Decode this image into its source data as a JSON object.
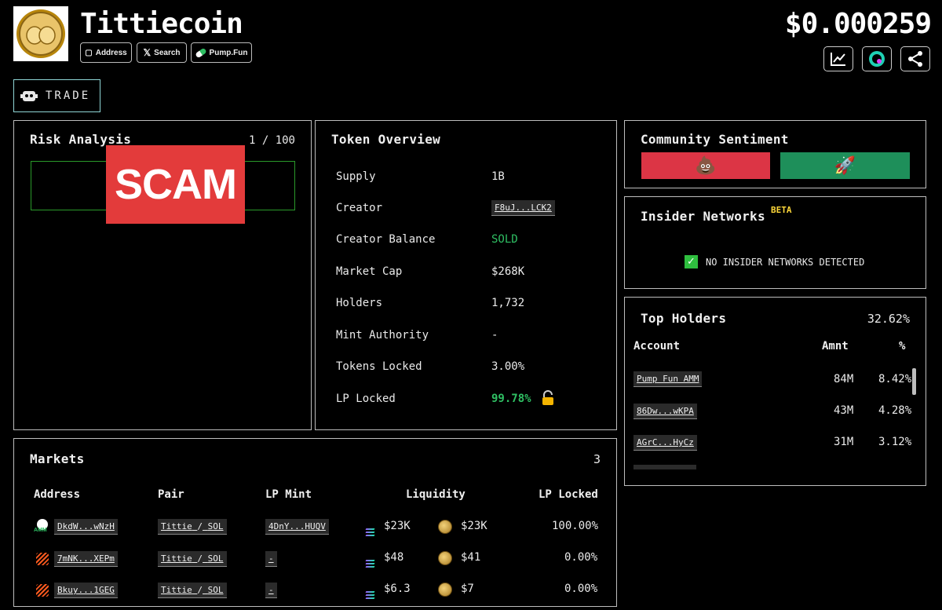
{
  "header": {
    "token_name": "Tittiecoin",
    "price": "$0.000259",
    "links": [
      {
        "label": "Address",
        "icon": "copy-icon"
      },
      {
        "label": "Search",
        "icon": "x-logo-icon"
      },
      {
        "label": "Pump.Fun",
        "icon": "pill-icon"
      }
    ],
    "trade_label": "TRADE"
  },
  "risk": {
    "title": "Risk Analysis",
    "score": "1 / 100",
    "badge": "SCAM"
  },
  "overview": {
    "title": "Token Overview",
    "rows": [
      {
        "label": "Supply",
        "value": "1B"
      },
      {
        "label": "Creator",
        "value": "F8uJ...LCK2"
      },
      {
        "label": "Creator Balance",
        "value": "SOLD"
      },
      {
        "label": "Market Cap",
        "value": "$268K"
      },
      {
        "label": "Holders",
        "value": "1,732"
      },
      {
        "label": "Mint Authority",
        "value": "-"
      },
      {
        "label": "Tokens Locked",
        "value": "3.00%"
      },
      {
        "label": "LP Locked",
        "value": "99.78%"
      }
    ]
  },
  "sentiment": {
    "title": "Community Sentiment",
    "bad_emoji": "💩",
    "good_emoji": "🚀",
    "bad_color": "#dc3545",
    "good_color": "#1e8f5a"
  },
  "insider": {
    "title": "Insider Networks",
    "tag": "BETA",
    "status": "NO INSIDER NETWORKS DETECTED"
  },
  "holders": {
    "title": "Top Holders",
    "total": "32.62%",
    "columns": [
      "Account",
      "Amnt",
      "%"
    ],
    "rows": [
      {
        "account": "Pump Fun AMM",
        "amount": "84M",
        "pct": "8.42%"
      },
      {
        "account": "86Dw...wKPA",
        "amount": "43M",
        "pct": "4.28%"
      },
      {
        "account": "AGrC...HyCz",
        "amount": "31M",
        "pct": "3.12%"
      }
    ]
  },
  "markets": {
    "title": "Markets",
    "count": "3",
    "columns": [
      "Address",
      "Pair",
      "LP Mint",
      "Liquidity",
      "LP Locked"
    ],
    "rows": [
      {
        "address": "DkdW...wNzH",
        "pair_base": "Tittie",
        "pair_sep": "/",
        "pair_quote": "SOL",
        "lp_mint": "4DnY...HUQV",
        "liq_sol": "$23K",
        "liq_token": "$23K",
        "lp_locked": "100.00%",
        "logo": "amm"
      },
      {
        "address": "7mNK...XEPm",
        "pair_base": "Tittie",
        "pair_sep": "/",
        "pair_quote": "SOL",
        "lp_mint": "-",
        "liq_sol": "$48",
        "liq_token": "$41",
        "lp_locked": "0.00%",
        "logo": "meteora"
      },
      {
        "address": "Bkuy...1GEG",
        "pair_base": "Tittie",
        "pair_sep": "/",
        "pair_quote": "SOL",
        "lp_mint": "-",
        "liq_sol": "$6.3",
        "liq_token": "$7",
        "lp_locked": "0.00%",
        "logo": "meteora"
      }
    ]
  }
}
